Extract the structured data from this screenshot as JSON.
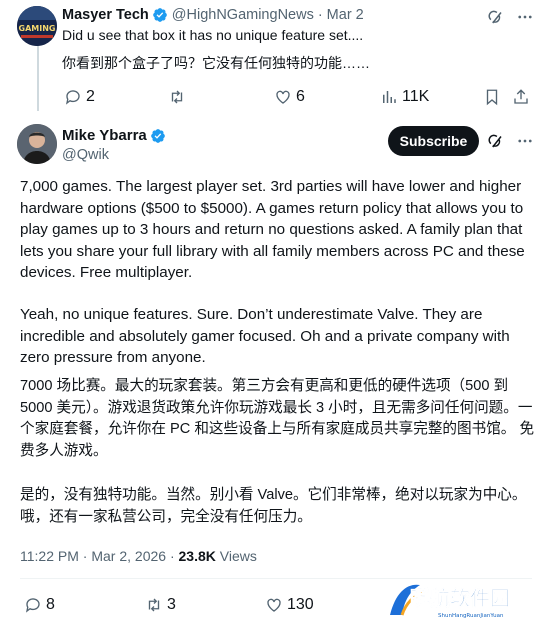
{
  "reply": {
    "name": "Masyer Tech",
    "handle": "@HighNGamingNews",
    "dot": "·",
    "date": "Mar 2",
    "text_en": "Did u see that box it has no unique feature set....",
    "text_zh": "你看到那个盒子了吗？它没有任何独特的功能……",
    "actions": {
      "replies": "2",
      "reposts": "",
      "likes": "6",
      "views": "11K"
    }
  },
  "main": {
    "name": "Mike Ybarra",
    "handle": "@Qwik",
    "subscribe_label": "Subscribe",
    "paragraphs": [
      "7,000 games. The largest player set. 3rd parties will have lower and higher hardware options ($500 to $5000). A games return policy that allows you to play games up to 3 hours and return no questions asked. A family plan that lets you share your full library with all family members across PC and these devices.  Free multiplayer.",
      "Yeah, no unique features. Sure. Don’t underestimate Valve. They are incredible and absolutely gamer focused. Oh and a private company with zero pressure from anyone.",
      "7000 场比赛。最大的玩家套装。第三方会有更高和更低的硬件选项（500 到 5000 美元）。游戏退货政策允许你玩游戏最长 3 小时，且无需多问任何问题。一个家庭套餐，允许你在 PC 和这些设备上与所有家庭成员共享完整的图书馆。 免费多人游戏。",
      "是的，没有独特功能。当然。别小看 Valve。它们非常棒，绝对以玩家为中心。哦，还有一家私营公司，完全没有任何压力。"
    ],
    "meta": {
      "time": "11:22 PM",
      "dot": "·",
      "date": "Mar 2, 2026",
      "views_count": "23.8K",
      "views_label": "Views"
    },
    "actions": {
      "replies": "8",
      "reposts": "3",
      "likes": "130"
    }
  },
  "watermark": {
    "title": "瞬航软件园",
    "subtitle": "ShunHangRuanJianYuan"
  },
  "colors": {
    "verified": "#1d9bf0",
    "muted": "#536471",
    "text": "#0f1419",
    "subscribe_bg": "#0f1419"
  }
}
